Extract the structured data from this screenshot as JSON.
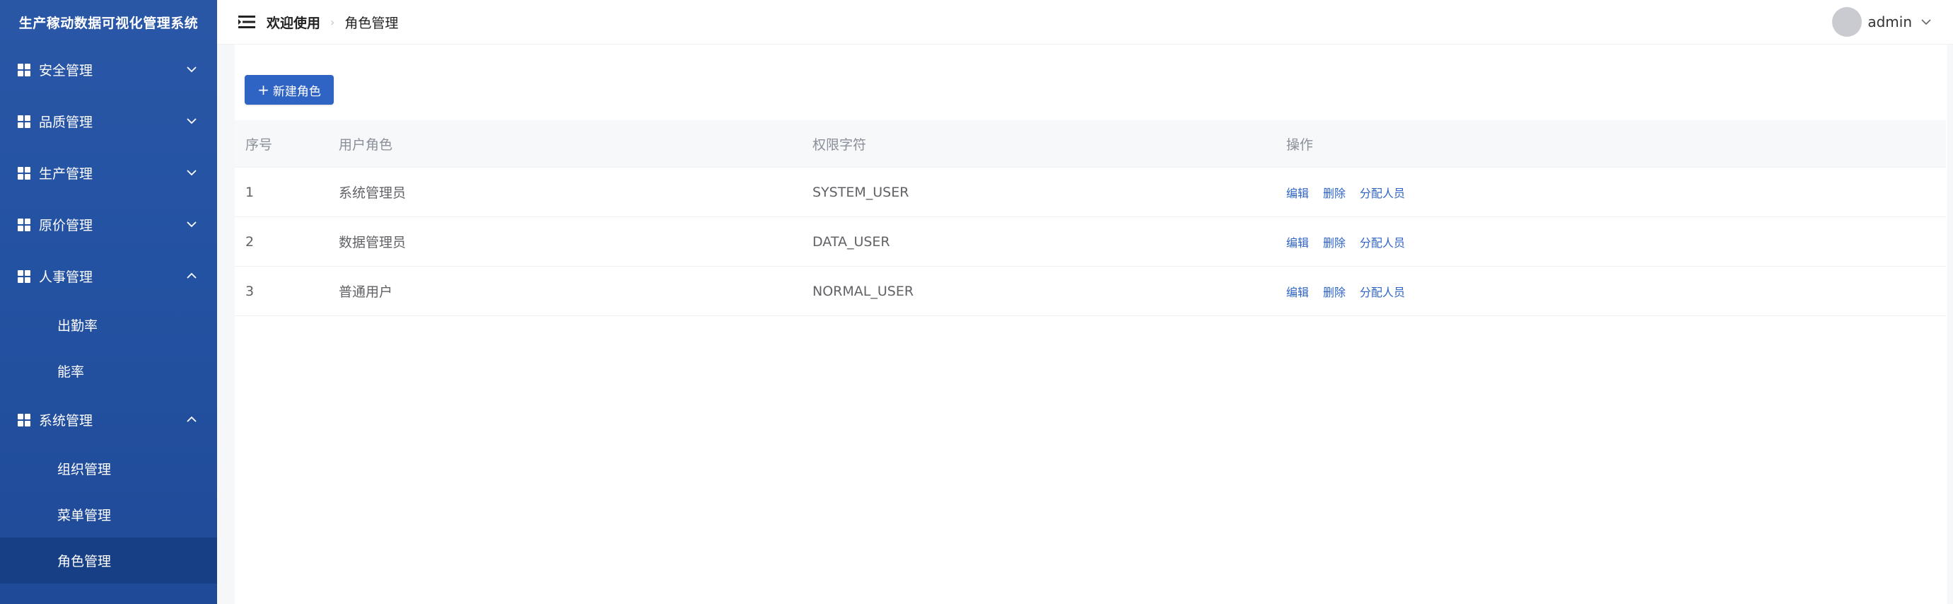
{
  "app": {
    "title": "生产稼动数据可视化管理系统"
  },
  "sidebar": {
    "menus": [
      {
        "label": "安全管理",
        "expanded": false
      },
      {
        "label": "品质管理",
        "expanded": false
      },
      {
        "label": "生产管理",
        "expanded": false
      },
      {
        "label": "原价管理",
        "expanded": false
      },
      {
        "label": "人事管理",
        "expanded": true,
        "children": [
          "出勤率",
          "能率"
        ]
      },
      {
        "label": "系统管理",
        "expanded": true,
        "children": [
          "组织管理",
          "菜单管理",
          "角色管理"
        ]
      }
    ],
    "active_item": "角色管理"
  },
  "header": {
    "breadcrumb": [
      "欢迎使用",
      "角色管理"
    ],
    "user": "admin"
  },
  "toolbar": {
    "new_label": "新建角色"
  },
  "table": {
    "columns": [
      "序号",
      "用户角色",
      "权限字符",
      "操作"
    ],
    "rows": [
      {
        "index": "1",
        "role": "系统管理员",
        "perm": "SYSTEM_USER"
      },
      {
        "index": "2",
        "role": "数据管理员",
        "perm": "DATA_USER"
      },
      {
        "index": "3",
        "role": "普通用户",
        "perm": "NORMAL_USER"
      }
    ],
    "actions": [
      "编辑",
      "删除",
      "分配人员"
    ]
  },
  "colors": {
    "sidebar": "#2452a2",
    "accent": "#2f64c4",
    "active": "#173f86"
  }
}
